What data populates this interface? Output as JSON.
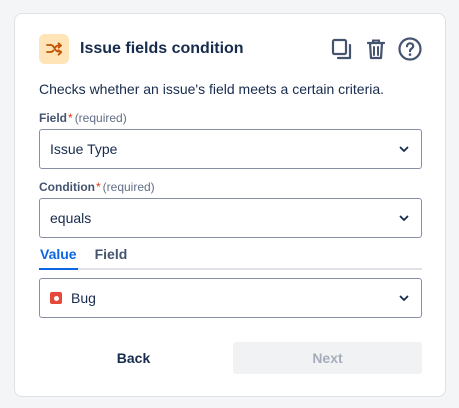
{
  "header": {
    "title": "Issue fields condition",
    "icon": "shuffle-icon",
    "actions": [
      "copy-icon",
      "trash-icon",
      "help-icon"
    ]
  },
  "description": "Checks whether an issue's field meets a certain criteria.",
  "field": {
    "label": "Field",
    "required_mark": "*",
    "required_text": "(required)",
    "value": "Issue Type"
  },
  "condition": {
    "label": "Condition",
    "required_mark": "*",
    "required_text": "(required)",
    "value": "equals"
  },
  "tabs": [
    {
      "label": "Value",
      "active": true
    },
    {
      "label": "Field",
      "active": false
    }
  ],
  "value_select": {
    "icon": "bug-icon",
    "value": "Bug"
  },
  "buttons": {
    "back": "Back",
    "next": "Next"
  },
  "colors": {
    "accent": "#0c66e4",
    "icon_bg": "#ffe4b8",
    "icon_fg": "#c25100",
    "bug": "#e5493a"
  }
}
